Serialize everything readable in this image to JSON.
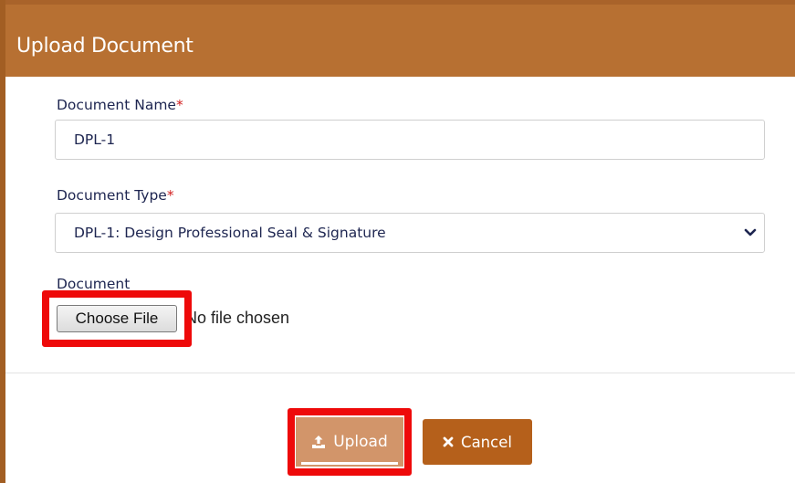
{
  "dialog": {
    "title": "Upload Document"
  },
  "form": {
    "document_name": {
      "label": "Document Name",
      "required_mark": "*",
      "value": "DPL-1"
    },
    "document_type": {
      "label": "Document Type",
      "required_mark": "*",
      "selected": "DPL-1: Design Professional Seal & Signature"
    },
    "document": {
      "label": "Document",
      "choose_button": "Choose File",
      "status": "No file chosen"
    }
  },
  "actions": {
    "upload_label": "Upload",
    "cancel_label": "Cancel"
  },
  "icons": {
    "upload": "upload-icon",
    "cancel": "close-icon",
    "select": "chevron-down-icon"
  },
  "colors": {
    "header_bg": "#b77032",
    "upload_bg": "#d2956a",
    "cancel_bg": "#b5601b",
    "highlight": "#ee0a0a",
    "label_text": "#1d2550"
  }
}
